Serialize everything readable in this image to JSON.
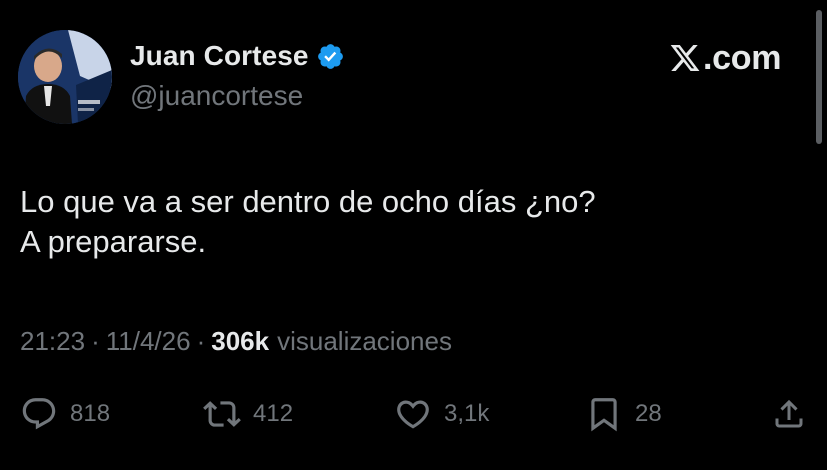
{
  "author": {
    "display_name": "Juan Cortese",
    "handle": "@juancortese",
    "verified": true,
    "avatar_icon": "profile-photo-icon",
    "avatar_logo_text": "TyC Sports"
  },
  "brand": {
    "icon": "x-logo-icon",
    "text": ".com"
  },
  "tweet": {
    "lines": [
      "Lo que va a ser dentro de ocho días ¿no?",
      "A prepararse."
    ]
  },
  "meta": {
    "time": "21:23",
    "separator": "·",
    "date": "11/4/26",
    "views_count": "306k",
    "views_label": "visualizaciones"
  },
  "actions": {
    "reply": {
      "icon": "reply-icon",
      "count": "818"
    },
    "retweet": {
      "icon": "retweet-icon",
      "count": "412"
    },
    "like": {
      "icon": "heart-icon",
      "count": "3,1k"
    },
    "bookmark": {
      "icon": "bookmark-icon",
      "count": "28"
    },
    "share": {
      "icon": "share-icon"
    }
  },
  "colors": {
    "background": "#000000",
    "primary_text": "#e7e9ea",
    "secondary_text": "#71767b",
    "verified_badge": "#1d9bf0"
  }
}
